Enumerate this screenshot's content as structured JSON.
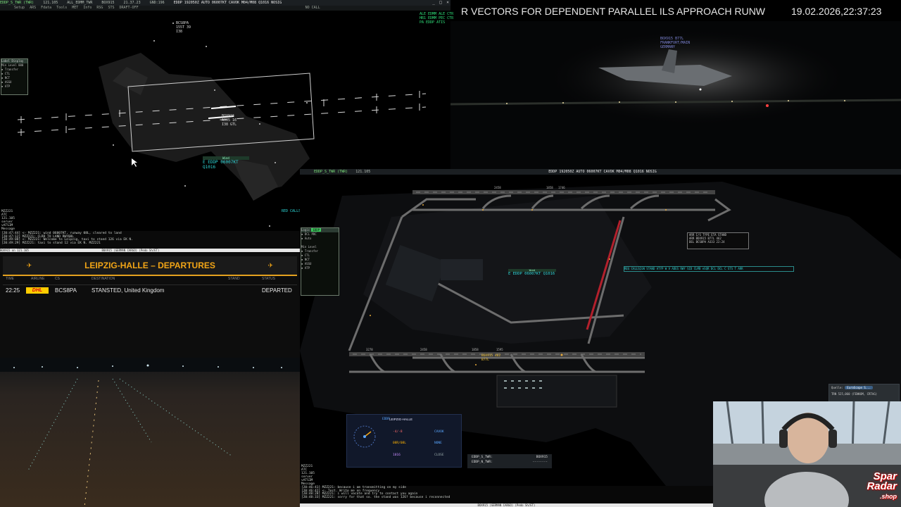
{
  "top_bar": {
    "items": [
      "EDDP_S_TWR (TWR)",
      "121.105",
      "ALL_EDMM_TWR",
      "BOX915",
      "21.37.23",
      "UTC 21:37:21",
      "1000",
      "GND:196",
      "EDDP 192050Z AUTO 06007KT CAVOK M04/M08 Q1016 NOSIG",
      "NO CALL"
    ],
    "menu": [
      "Setup",
      "ARS",
      "Fdata",
      "Tools",
      "MET",
      "Info",
      "RSG",
      "STS",
      "DRAFT-OFF",
      "KDDD",
      "SSSS"
    ]
  },
  "tr_atis": [
    "ALE EDMM ALE CTR",
    "HR1 EDMM PEC CTR",
    "PA EDDP ATIS"
  ],
  "ticker": "R VECTORS FOR DEPENDENT PARALLEL ILS APPROACH RUNW",
  "clock": "19.02.2026,22:37:23",
  "video_tag": {
    "line1": "BOX915  B77L",
    "line2": "FRANKFURT/MAIN",
    "line3": "GERMANY"
  },
  "radar_left": {
    "label_top": "BCS8PA",
    "label_top2": "155T 39",
    "label_top3": "I38",
    "ac_label": "BOX915",
    "ac_label2": "A005 16",
    "ac_label3": "I38 GTL",
    "metar_header": "Wind",
    "metar_box": "E EDDP 06007KT Q1016",
    "red_calls": "RED CALLS",
    "atc_box": [
      "MZZ221",
      "ATC",
      "121.105",
      "server",
      "vATSIM",
      "Message"
    ],
    "level_filter": {
      "title": "Label Display",
      "sub": "Min Level 000",
      "items": [
        "Transfer",
        "CTL",
        "NCT",
        "ASSU",
        "ATP"
      ]
    }
  },
  "left_messages": [
    "[20:47:44] <- MZZ221: wind 06007KT, runway 08L, cleared to land",
    "[20:47:12] MZZ221: CLRD TO LAND RWY08L",
    "[20:49:08] <- MZZ221: Welcome to Leipzig, taxi to stand 126 via EK N.",
    "[20:49:29] MZZ221: taxi to stand 12 via EK N. MZZ221"
  ],
  "left_status": "BOX915 on 121.105                                           B0X915 (GERMAN CARGO) (Pedo Sh/ET)",
  "departures": {
    "title": "LEIPZIG-HALLE – DEPARTURES",
    "columns": [
      "TIME",
      "AIRLINE",
      "CS",
      "DESTINATION",
      "STAND",
      "STATUS"
    ],
    "rows": [
      {
        "time": "22:25",
        "airline": "DHL",
        "cs": "BCS8PA",
        "destination": "STANSTED, United Kingdom",
        "stand": "",
        "status": "DEPARTED"
      }
    ]
  },
  "ground_window": {
    "title": "EDDP_S_TWR (TWR)",
    "freq": "121.105",
    "metar": "EDDP 192050Z AUTO 06007KT CAVOK M04/M08 Q1016 NOSIG",
    "date": "19-02-26 21:37:21",
    "red_calls": "RED CALLS",
    "metar_box": "E EDDP 06007KT Q1016",
    "callsign_header": "REG CALLSIGN  STAND ATYP W V ADES RWY  SID  CLMB eSQR DCL DCL C STS T  ARR",
    "rwy_labels": [
      "2458",
      "1858",
      "1746",
      "3278",
      "2458",
      "1858",
      "1595"
    ],
    "acft_label": "BOX915 462",
    "acft_label2": "B77L",
    "strip_rows": [
      "ARR  I/S    TYPE ETA  STAND",
      "ARR  BOX915  B77L      462",
      "DEL  BCS8PA  A333 22:24"
    ]
  },
  "sector_panel": {
    "title": "Logic",
    "code": "EDDP",
    "items": [
      "DCL PDC",
      "Auto",
      "Min Level",
      "Transfer",
      "CTL",
      "NCT",
      "ASSU",
      "ATP"
    ]
  },
  "ops_panel": {
    "code": "EDDP",
    "title": "LEIPZIG-HALLE",
    "right": [
      "CAVOK",
      "NONE",
      "CLOSE"
    ],
    "left": [
      "-4/-8",
      "08R/08L",
      "1016"
    ]
  },
  "status_box": {
    "l1": "EDDP_S_TWR:",
    "v1": "BOX915",
    "l2": "EDDP_N_TWR:",
    "v2": "--------"
  },
  "bottom_messages": [
    "[20:46:41] MZZ221: because i am transmitting on my side",
    "[20:46:42] <- Test. Write me on frequency",
    "[20:48:28] MZZ221: i will vacate and try to contact you again",
    "[20:48:33] MZZ221: sorry for that so. the stand was 126? because i reconnected"
  ],
  "bottom_status": "BOX915 (GERMAN CARGO) (Pedo Sh/ET)",
  "bottom_atc": [
    "MZZ221",
    "ATC",
    "121.105",
    "server",
    "vATSIM",
    "Message"
  ],
  "qbox": {
    "label": "Quelle:",
    "btn": "EuroScope S...",
    "text": "TRN 525,060 (FENKOM, CRTAG)"
  },
  "watermark": {
    "line1": "Spar",
    "line2": "Radar",
    "line3": ".shop"
  }
}
